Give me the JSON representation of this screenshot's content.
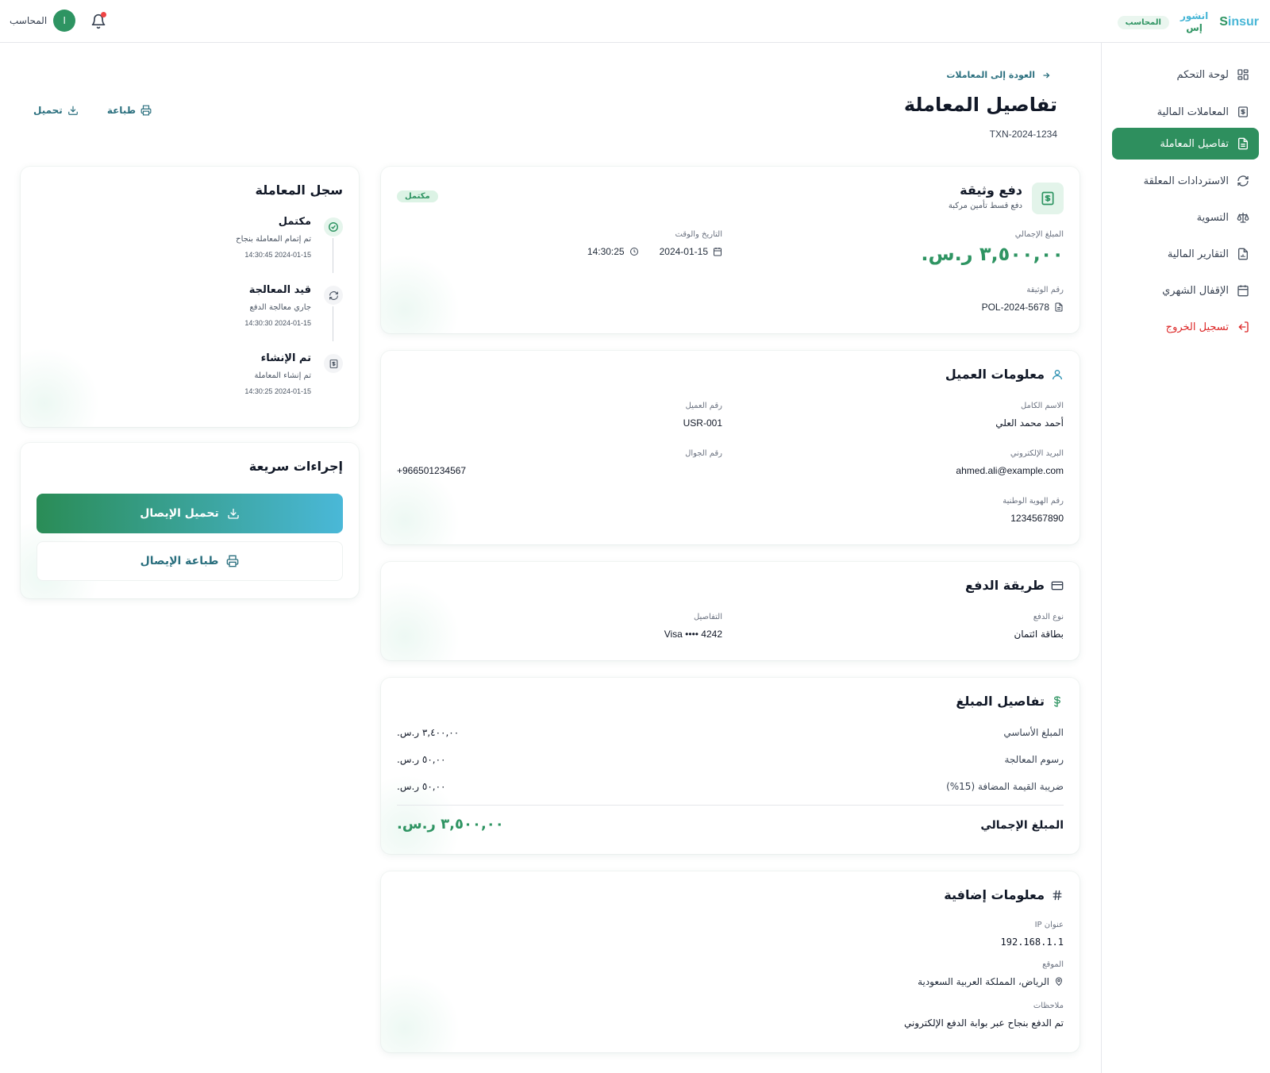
{
  "header": {
    "brand_en": "insur",
    "brand_en_mark": "S",
    "brand_ar_line1": "انشور",
    "brand_ar_line2": "إس",
    "role_badge": "المحاسب",
    "user_name": "المحاسب",
    "avatar_initial": "ا"
  },
  "sidebar": {
    "items": [
      {
        "label": "لوحة التحكم",
        "icon": "dashboard-icon"
      },
      {
        "label": "المعاملات المالية",
        "icon": "financial-transactions-icon"
      },
      {
        "label": "تفاصيل المعاملة",
        "icon": "document-icon",
        "active": true
      },
      {
        "label": "الاستردادات المعلقة",
        "icon": "refresh-icon"
      },
      {
        "label": "التسوية",
        "icon": "scale-icon"
      },
      {
        "label": "التقارير المالية",
        "icon": "report-icon"
      },
      {
        "label": "الإقفال الشهري",
        "icon": "calendar-icon"
      },
      {
        "label": "تسجيل الخروج",
        "icon": "logout-icon"
      }
    ]
  },
  "page": {
    "back_label": "العودة إلى المعاملات",
    "title": "تفاصيل المعاملة",
    "transaction_id": "TXN-2024-1234",
    "print_label": "طباعة",
    "download_label": "تحميل"
  },
  "summary": {
    "title": "دفع وثيقة",
    "subtitle": "دفع قسط تأمين مركبة",
    "status": "مكتمل",
    "total_label": "المبلغ الإجمالي",
    "total_value": "٣,٥٠٠,٠٠ ر.س.",
    "datetime_label": "التاريخ والوقت",
    "date": "2024-01-15",
    "time": "14:30:25",
    "policy_label": "رقم الوثيقة",
    "policy_value": "POL-2024-5678"
  },
  "customer": {
    "title": "معلومات العميل",
    "full_name_label": "الاسم الكامل",
    "full_name": "أحمد محمد العلي",
    "customer_id_label": "رقم العميل",
    "customer_id": "USR-001",
    "email_label": "البريد الإلكتروني",
    "email": "ahmed.ali@example.com",
    "mobile_label": "رقم الجوال",
    "mobile": "+966501234567",
    "national_id_label": "رقم الهوية الوطنية",
    "national_id": "1234567890"
  },
  "payment": {
    "title": "طريقة الدفع",
    "type_label": "نوع الدفع",
    "type_value": "بطاقة ائتمان",
    "details_label": "التفاصيل",
    "details_value": "Visa •••• 4242"
  },
  "amounts": {
    "title": "تفاصيل المبلغ",
    "rows": [
      {
        "label": "المبلغ الأساسي",
        "value": "٣,٤٠٠,٠٠ ر.س."
      },
      {
        "label": "رسوم المعالجة",
        "value": "٥٠,٠٠ ر.س."
      },
      {
        "label": "ضريبة القيمة المضافة (15%)",
        "value": "٥٠,٠٠ ر.س."
      }
    ],
    "total_label": "المبلغ الإجمالي",
    "total_value": "٣,٥٠٠,٠٠ ر.س."
  },
  "additional": {
    "title": "معلومات إضافية",
    "ip_label": "عنوان IP",
    "ip_value": "192.168.1.1",
    "location_label": "الموقع",
    "location_value": "الرياض، المملكة العربية السعودية",
    "notes_label": "ملاحظات",
    "notes_value": "تم الدفع بنجاح عبر بوابة الدفع الإلكتروني"
  },
  "timeline": {
    "title": "سجل المعاملة",
    "events": [
      {
        "title": "مكتمل",
        "desc": "تم إتمام المعاملة بنجاح",
        "time": "2024-01-15 14:30:45"
      },
      {
        "title": "قيد المعالجة",
        "desc": "جاري معالجة الدفع",
        "time": "2024-01-15 14:30:30"
      },
      {
        "title": "تم الإنشاء",
        "desc": "تم إنشاء المعاملة",
        "time": "2024-01-15 14:30:25"
      }
    ]
  },
  "quick_actions": {
    "title": "إجراءات سريعة",
    "download_receipt": "تحميل الإيصال",
    "print_receipt": "طباعة الإيصال"
  },
  "colors": {
    "primary_green": "#2e8f5e",
    "accent_blue": "#4ab8d8",
    "link_teal": "#2a6f7e",
    "logout_red": "#dc2626"
  }
}
